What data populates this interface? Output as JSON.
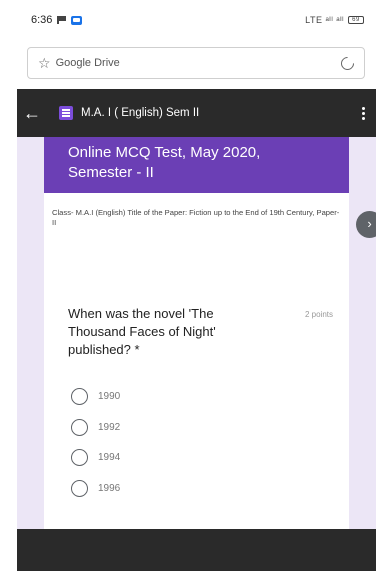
{
  "status_bar": {
    "time": "6:36",
    "signal_text": "LTE ᵃᴵˡ ᵃᴵˡ",
    "battery": "69"
  },
  "browser": {
    "url_text": "Google Drive"
  },
  "app_bar": {
    "title": "M.A. I ( English) Sem II"
  },
  "form": {
    "header_title": "Online MCQ Test, May 2020, Semester - II",
    "description": "Class- M.A.I (English)     Title of the Paper: Fiction up to the End of 19th Century,     Paper- II",
    "question": {
      "text": "When was the novel 'The Thousand Faces of Night' published? *",
      "points": "2 points",
      "options": [
        "1990",
        "1992",
        "1994",
        "1996"
      ]
    }
  },
  "colors": {
    "accent": "#6b3fb5",
    "background": "#ece6f6",
    "app_bar": "#2a2a2a"
  }
}
